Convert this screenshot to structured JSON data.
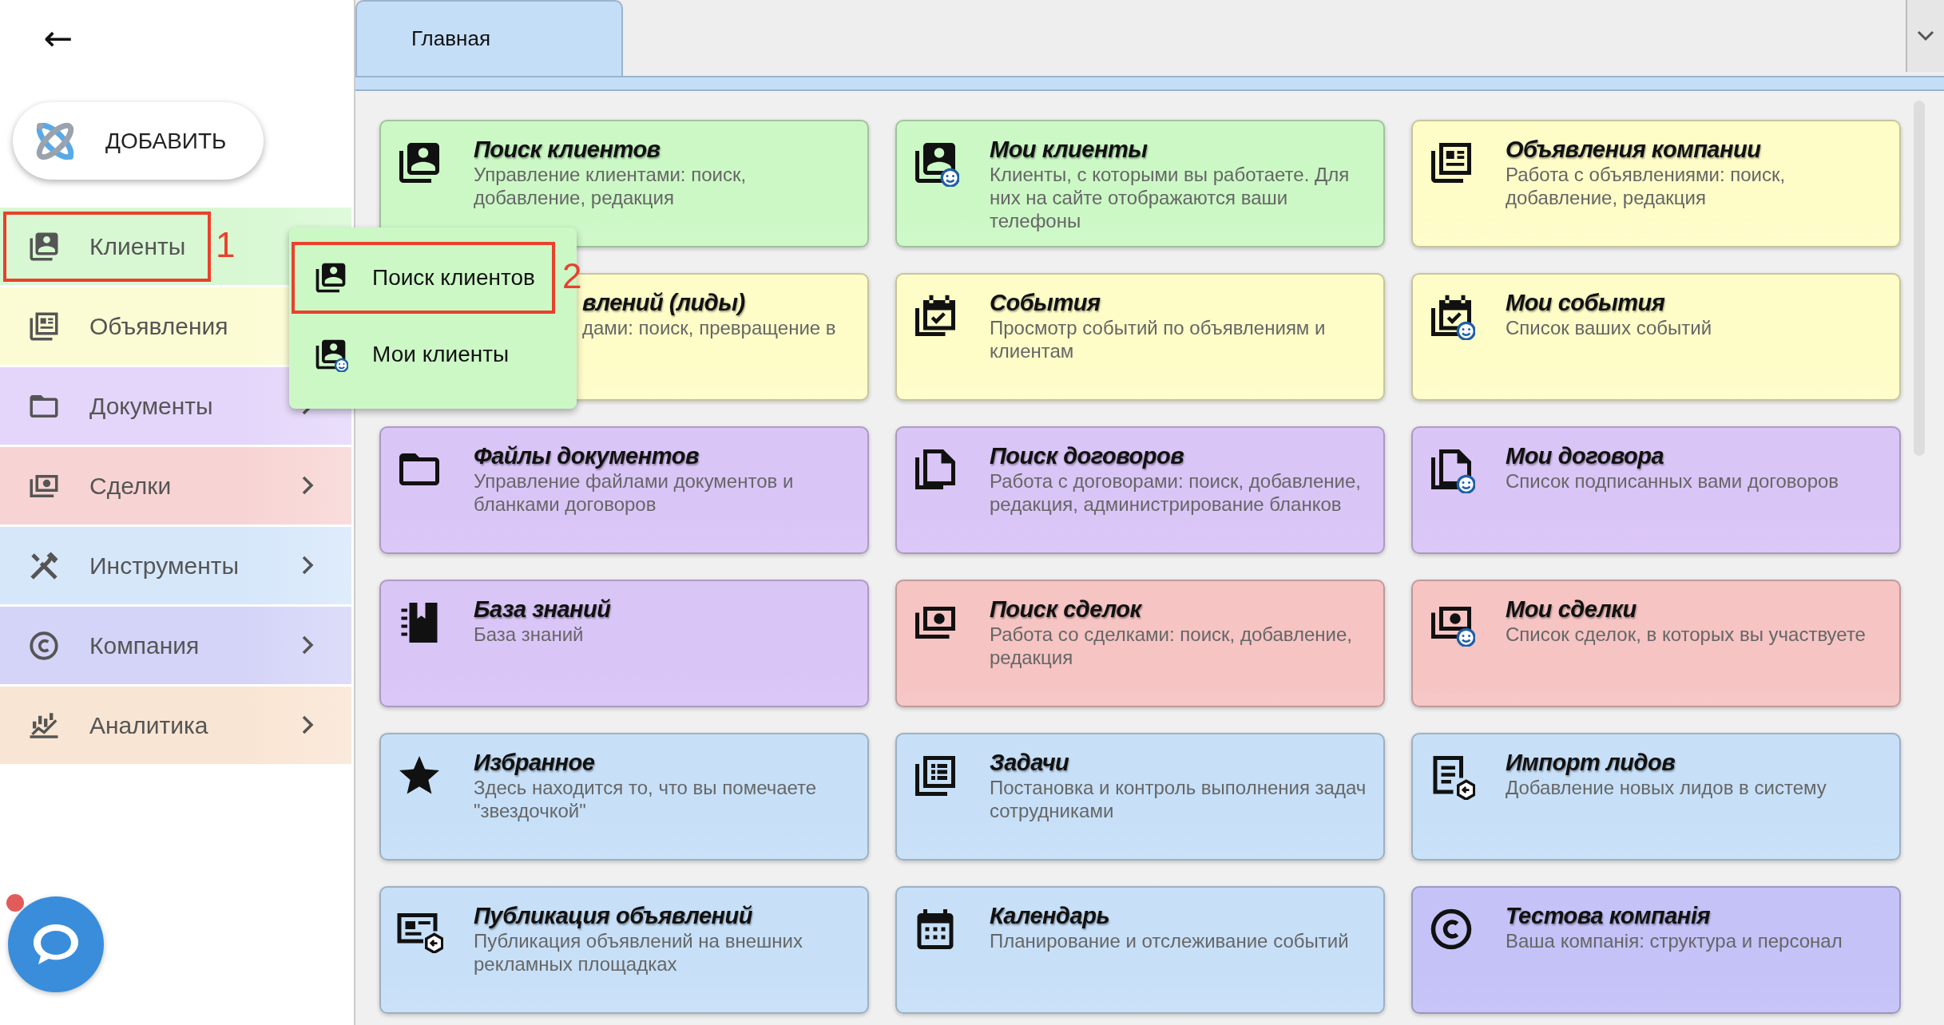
{
  "back_button": {
    "label": "←"
  },
  "add_button": {
    "label": "ДОБАВИТЬ"
  },
  "sidebar": {
    "items": [
      {
        "label": "Клиенты",
        "color": "#d8f8d3",
        "chevron": false,
        "callout": "1"
      },
      {
        "label": "Объявления",
        "color": "#fcfcd4",
        "chevron": false
      },
      {
        "label": "Документы",
        "color": "#e4d6fa",
        "chevron": true
      },
      {
        "label": "Сделки",
        "color": "#f7d4d3",
        "chevron": true
      },
      {
        "label": "Инструменты",
        "color": "#d6e7fa",
        "chevron": true
      },
      {
        "label": "Компания",
        "color": "#d4d4f8",
        "chevron": true
      },
      {
        "label": "Аналитика",
        "color": "#f9e5d3",
        "chevron": true
      }
    ]
  },
  "submenu": {
    "items": [
      {
        "label": "Поиск клиентов",
        "callout": "2"
      },
      {
        "label": "Мои клиенты"
      }
    ]
  },
  "chat_button": {
    "unread": true
  },
  "tabs": [
    {
      "label": "Главная",
      "selected": true
    }
  ],
  "cards": [
    {
      "title": "Поиск клиентов",
      "description": "Управление клиентами: поиск, добавление, редакция",
      "color": "#ccf8c6"
    },
    {
      "title": "Мои клиенты",
      "description": "Клиенты, с которыми вы работаете. Для них на сайте отображаются ваши телефоны",
      "color": "#ccf8c6"
    },
    {
      "title": "Объявления компании",
      "description": "Работа с объявлениями: поиск, добавление, редакция",
      "color": "#fefdc8"
    },
    {
      "title": "влений (лиды)",
      "description": "дами: поиск, превращение в",
      "color": "#fefdc8",
      "kind": "covered"
    },
    {
      "title": "События",
      "description": "Просмотр событий по объявлениям и клиентам",
      "color": "#fefdc8"
    },
    {
      "title": "Мои события",
      "description": "Список ваших событий",
      "color": "#fefdc8"
    },
    {
      "title": "Файлы документов",
      "description": "Управление файлами документов и бланками договоров",
      "color": "#dac5f7"
    },
    {
      "title": "Поиск договоров",
      "description": "Работа с договорами: поиск, добавление, редакция, администрирование бланков",
      "color": "#dac5f7"
    },
    {
      "title": "Мои договора",
      "description": "Список подписанных вами договоров",
      "color": "#dac5f7"
    },
    {
      "title": "База знаний",
      "description": "База знаний",
      "color": "#dac5f7"
    },
    {
      "title": "Поиск сделок",
      "description": "Работа со сделками: поиск, добавление, редакция",
      "color": "#f5c4c3"
    },
    {
      "title": "Мои сделки",
      "description": "Список сделок, в которых вы участвуете",
      "color": "#f5c4c3"
    },
    {
      "title": "Избранное",
      "description": "Здесь находится то, что вы помечаете \"звездочкой\"",
      "color": "#c7e0f8"
    },
    {
      "title": "Задачи",
      "description": "Постановка и контроль выполнения задач сотрудниками",
      "color": "#c7e0f8"
    },
    {
      "title": "Импорт лидов",
      "description": "Добавление новых лидов в систему",
      "color": "#c7e0f8"
    },
    {
      "title": "Публикация объявлений",
      "description": "Публикация объявлений на внешних рекламных площадках",
      "color": "#c7e0f8"
    },
    {
      "title": "Календарь",
      "description": "Планирование и отслеживание событий",
      "color": "#c7e0f8"
    },
    {
      "title": "Тестова компанія",
      "description": "Ваша компанія: структура и персонал",
      "color": "#c4c2f7"
    }
  ]
}
